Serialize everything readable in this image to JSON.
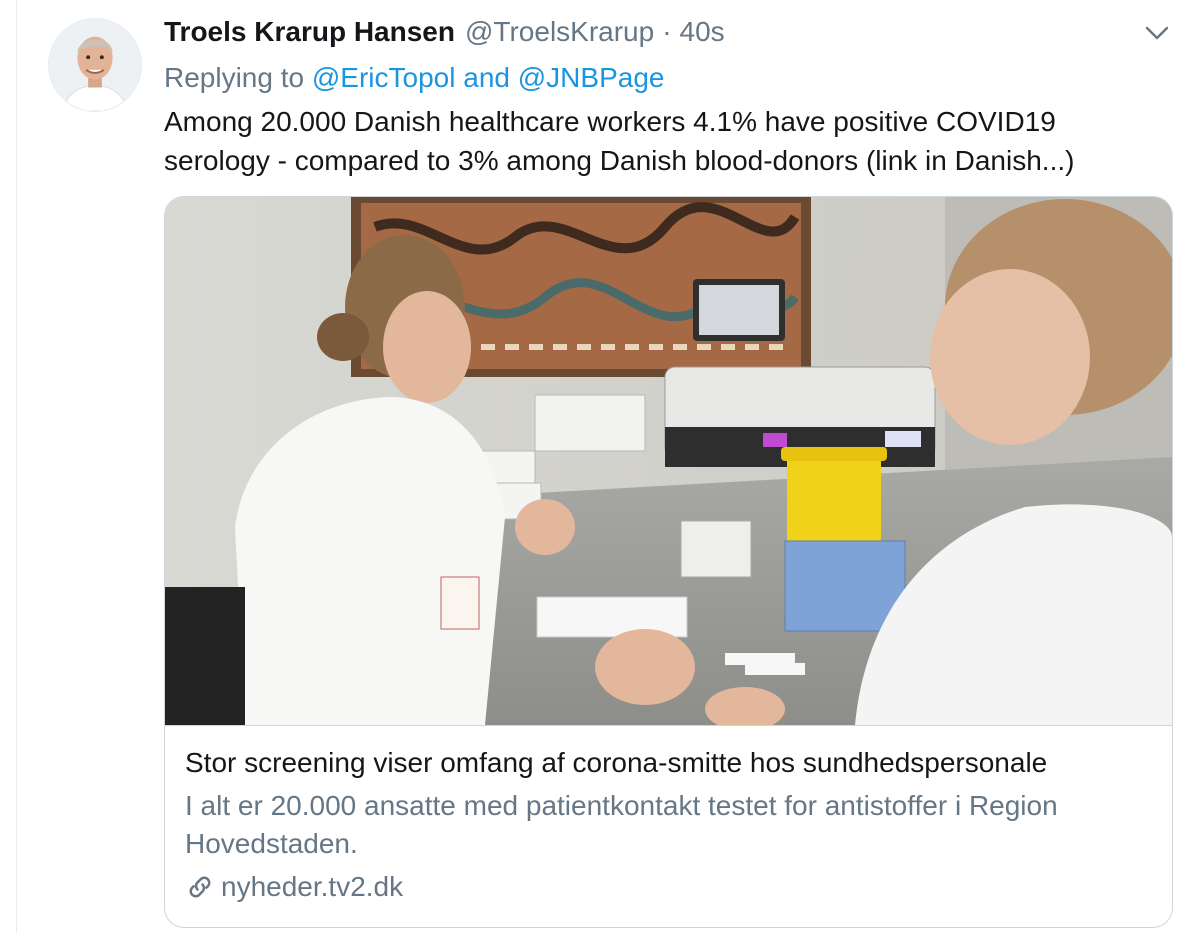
{
  "tweet": {
    "author_name": "Troels Krarup Hansen",
    "handle": "@TroelsKrarup",
    "separator": "·",
    "time": "40s",
    "replying_prefix": "Replying to",
    "reply_to_1": "@EricTopol",
    "reply_conjunction": "and",
    "reply_to_2": "@JNBPage",
    "text_line_1": "Among 20.000 Danish  healthcare workers 4.1% have positive COVID19",
    "text_line_2": "serology - compared to 3% among Danish blood-donors (link in Danish...)"
  },
  "card": {
    "title": "Stor screening viser omfang af corona-smitte hos sundhedspersonale",
    "description_line_1": "I alt er 20.000 ansatte med patientkontakt testet for antistoffer i Region",
    "description_line_2": "Hovedstaden.",
    "domain": "nyheder.tv2.dk"
  },
  "icons": {
    "caret": "chevron-down-icon",
    "link": "link-icon"
  },
  "colors": {
    "link_blue": "#1b95e0",
    "secondary_text": "#657786",
    "primary_text": "#14171a",
    "border": "#ccd6dd"
  }
}
